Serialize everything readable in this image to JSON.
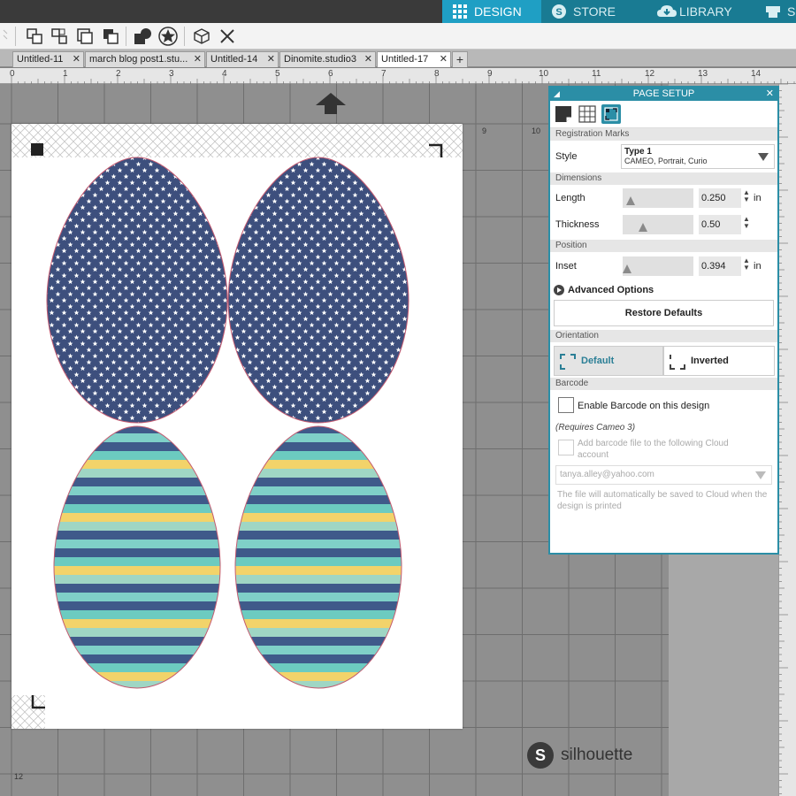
{
  "nav": {
    "design": "DESIGN",
    "store": "STORE",
    "library": "LIBRARY",
    "extra": "S",
    "accent": "#1f9fc4",
    "inactive": "#197b93"
  },
  "toolbar": {
    "icons": [
      "group-icon",
      "ungroup-icon",
      "compound-icon",
      "release-compound-icon",
      "shape-fill-icon",
      "star-shape-icon",
      "3d-box-icon",
      "close-icon"
    ]
  },
  "tabs": [
    {
      "label": "Untitled-11"
    },
    {
      "label": "march blog post1.stu..."
    },
    {
      "label": "Untitled-14"
    },
    {
      "label": "Dinomite.studio3"
    },
    {
      "label": "Untitled-17",
      "active": true
    }
  ],
  "tab_add": "+",
  "ruler": {
    "top_numbers": [
      "0",
      "1",
      "2",
      "3",
      "4",
      "5",
      "6",
      "7",
      "8",
      "9",
      "10",
      "11",
      "12",
      "13",
      "14"
    ],
    "canvas_labels": [
      "9",
      "10"
    ],
    "bottom_label": "12"
  },
  "brand": {
    "mark": "S",
    "name": "silhouette"
  },
  "eggs": {
    "star_color": "#3d4f7d",
    "stripe_colors": [
      "#3f5a8a",
      "#6ccbc0",
      "#f2d36a",
      "#9fd6c4"
    ]
  },
  "panel": {
    "title": "PAGE SETUP",
    "close": "✕",
    "dock": "◢",
    "sections": {
      "registration": "Registration Marks",
      "dimensions": "Dimensions",
      "position": "Position",
      "orientation": "Orientation",
      "barcode": "Barcode"
    },
    "style": {
      "label": "Style",
      "value_line1": "Type 1",
      "value_line2": "CAMEO, Portrait, Curio"
    },
    "length": {
      "label": "Length",
      "value": "0.250",
      "unit": "in"
    },
    "thickness": {
      "label": "Thickness",
      "value": "0.50"
    },
    "inset": {
      "label": "Inset",
      "value": "0.394",
      "unit": "in"
    },
    "advanced": "Advanced Options",
    "restore": "Restore Defaults",
    "orientation_default": "Default",
    "orientation_inverted": "Inverted",
    "barcode_enable": "Enable Barcode on this design",
    "requires": "(Requires Cameo 3)",
    "cloud_text": "Add barcode file to the following Cloud account",
    "cloud_account": "tanya.alley@yahoo.com",
    "cloud_note": "The file will automatically be saved to Cloud when the design is printed",
    "spin_up": "▲",
    "spin_down": "▼"
  }
}
